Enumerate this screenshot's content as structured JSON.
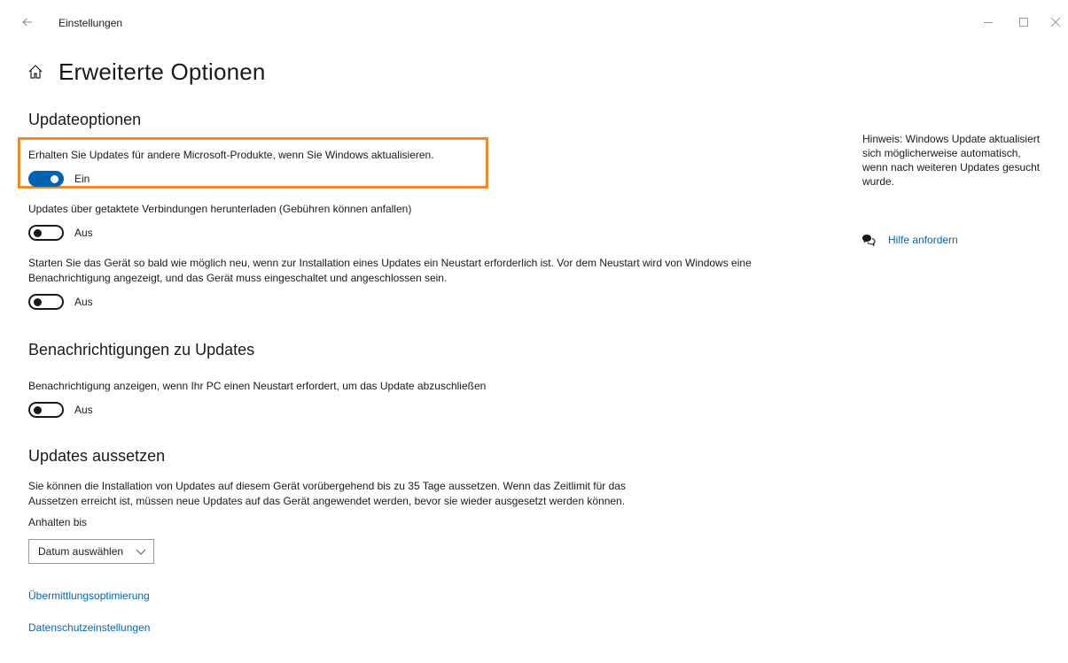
{
  "window": {
    "app_title": "Einstellungen",
    "controls": {
      "back_icon": "arrow-left-icon",
      "minimize_icon": "minimize-icon",
      "maximize_icon": "maximize-icon",
      "close_icon": "close-icon"
    }
  },
  "header": {
    "home_icon": "home-icon",
    "title": "Erweiterte Optionen"
  },
  "sections": {
    "update_options": {
      "title": "Updateoptionen",
      "settings": [
        {
          "description": "Erhalten Sie Updates für andere Microsoft-Produkte, wenn Sie Windows aktualisieren.",
          "state": "on",
          "state_label": "Ein"
        },
        {
          "description": "Updates über getaktete Verbindungen herunterladen (Gebühren können anfallen)",
          "state": "off",
          "state_label": "Aus"
        },
        {
          "description_line1": "Starten Sie das Gerät so bald wie möglich neu, wenn zur Installation eines Updates ein Neustart erforderlich ist. Vor dem Neustart wird von Windows eine",
          "description_line2": "Benachrichtigung angezeigt, und das Gerät muss eingeschaltet und angeschlossen sein.",
          "state": "off",
          "state_label": "Aus"
        }
      ]
    },
    "notifications": {
      "title": "Benachrichtigungen zu Updates",
      "settings": [
        {
          "description": "Benachrichtigung anzeigen, wenn Ihr PC einen Neustart erfordert, um das Update abzuschließen",
          "state": "off",
          "state_label": "Aus"
        }
      ]
    },
    "pause": {
      "title": "Updates aussetzen",
      "description_line1": "Sie können die Installation von Updates auf diesem Gerät vorübergehend bis zu 35 Tage aussetzen. Wenn das Zeitlimit für das",
      "description_line2": "Aussetzen erreicht ist, müssen neue Updates auf das Gerät angewendet werden, bevor sie wieder ausgesetzt werden können.",
      "pause_until_label": "Anhalten bis",
      "date_select_value": "Datum auswählen"
    }
  },
  "links": {
    "delivery_optimization": "Übermittlungsoptimierung",
    "privacy_settings": "Datenschutzeinstellungen"
  },
  "sidebar": {
    "hint_line1": "Hinweis: Windows Update aktualisiert",
    "hint_line2": "sich möglicherweise automatisch,",
    "hint_line3": "wenn nach weiteren Updates gesucht",
    "hint_line4": "wurde.",
    "help_icon": "help-chat-icon",
    "help_label": "Hilfe anfordern"
  },
  "colors": {
    "accent": "#0063b1",
    "link": "#0067b8",
    "highlight": "#f0892b"
  }
}
